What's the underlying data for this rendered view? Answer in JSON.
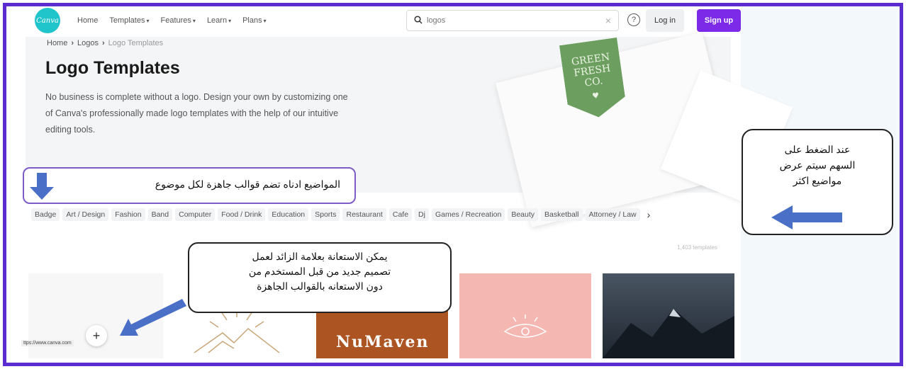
{
  "header": {
    "logo_text": "Canva",
    "nav": [
      "Home",
      "Templates",
      "Features",
      "Learn",
      "Plans"
    ],
    "search_value": "logos",
    "help": "?",
    "login": "Log in",
    "signup": "Sign up"
  },
  "breadcrumb": {
    "home": "Home",
    "logos": "Logos",
    "current": "Logo Templates"
  },
  "hero": {
    "title": "Logo Templates",
    "description": "No business is complete without a logo. Design your own by customizing one of Canva's professionally made logo templates with the help of our intuitive editing tools.",
    "tag_text": "GREEN FRESH CO."
  },
  "categories": [
    "Badge",
    "Art / Design",
    "Fashion",
    "Band",
    "Computer",
    "Food / Drink",
    "Education",
    "Sports",
    "Restaurant",
    "Cafe",
    "Dj",
    "Games / Recreation",
    "Beauty",
    "Basketball",
    "Attorney / Law"
  ],
  "template_count": "1,403 templates",
  "tiles": {
    "numaven": "NuMaven"
  },
  "status_url": "ttps://www.canva.com",
  "annotations": {
    "topics": "المواضيع ادناه تضم قوالب جاهزة لكل موضوع",
    "plus_line1": "يمكن الاستعانة بعلامة الزائد لعمل",
    "plus_line2": "تصميم جديد من قبل المستخدم من",
    "plus_line3": "دون الاستعانه بالقوالب الجاهزة",
    "arrow_line1": "عند الضغط على",
    "arrow_line2": "السهم سيتم عرض",
    "arrow_line3": "مواضيع اكثر"
  },
  "colors": {
    "frame": "#5b2ccf",
    "brand": "#20c4cb",
    "signup": "#7d2ae8",
    "arrow": "#4a6fc7"
  }
}
